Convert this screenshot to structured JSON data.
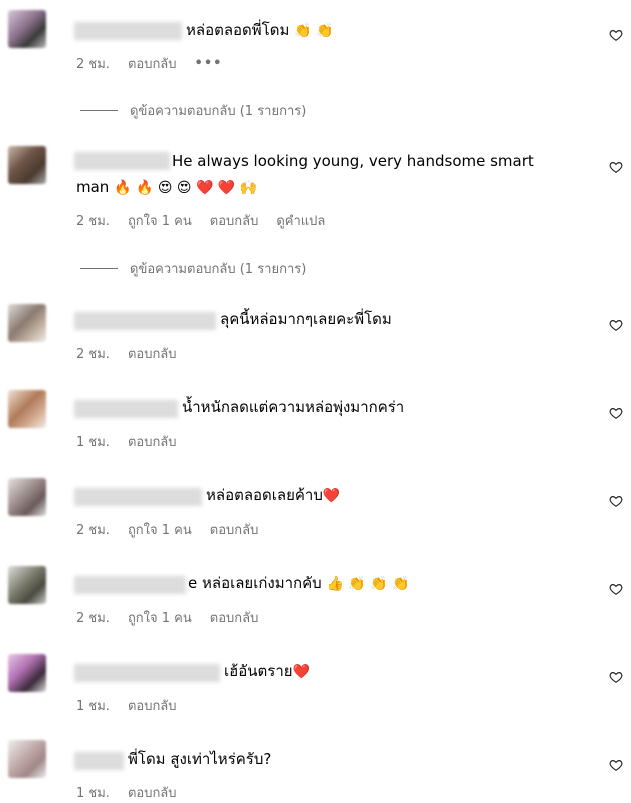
{
  "comments": [
    {
      "text": "หล่อตลอดพี่โดม",
      "emoji": "👏 👏",
      "time": "2 ชม.",
      "likes": "",
      "reply": "ตอบกลับ",
      "more": "•••",
      "translate": ""
    },
    {
      "text": "He always looking young, very handsome smart",
      "text2": "man",
      "emoji": "🔥 🔥 😍 😍 ❤️ ❤️ 🙌",
      "time": "2 ชม.",
      "likes": "ถูกใจ 1 คน",
      "reply": "ตอบกลับ",
      "translate": "ดูคำแปล"
    },
    {
      "text": "ลุคนี้หล่อมากๆเลยคะพี่โดม",
      "emoji": "",
      "time": "2 ชม.",
      "likes": "",
      "reply": "ตอบกลับ"
    },
    {
      "text": "น้ำหนักลดแต่ความหล่อพุ่งมากคร่า",
      "emoji": "",
      "time": "1 ชม.",
      "likes": "",
      "reply": "ตอบกลับ"
    },
    {
      "text": "หล่อตลอดเลยค้าบ",
      "emoji": "❤️",
      "time": "2 ชม.",
      "likes": "ถูกใจ 1 คน",
      "reply": "ตอบกลับ"
    },
    {
      "text": "e หล่อเลยเก่งมากคับ",
      "emoji": "👍 👏 👏 👏",
      "time": "2 ชม.",
      "likes": "ถูกใจ 1 คน",
      "reply": "ตอบกลับ"
    },
    {
      "text": "เฮ้อันตราย",
      "emoji": "❤️",
      "time": "1 ชม.",
      "likes": "",
      "reply": "ตอบกลับ"
    },
    {
      "text": "พี่โดม สูงเท่าไหร่ครับ?",
      "emoji": "",
      "time": "1 ชม.",
      "likes": "",
      "reply": "ตอบกลับ"
    }
  ],
  "view_replies": [
    "ดูข้อความตอบกลับ (1 รายการ)",
    "ดูข้อความตอบกลับ (1 รายการ)"
  ],
  "colors": {
    "meta": "#737373",
    "heart": "#262626"
  }
}
